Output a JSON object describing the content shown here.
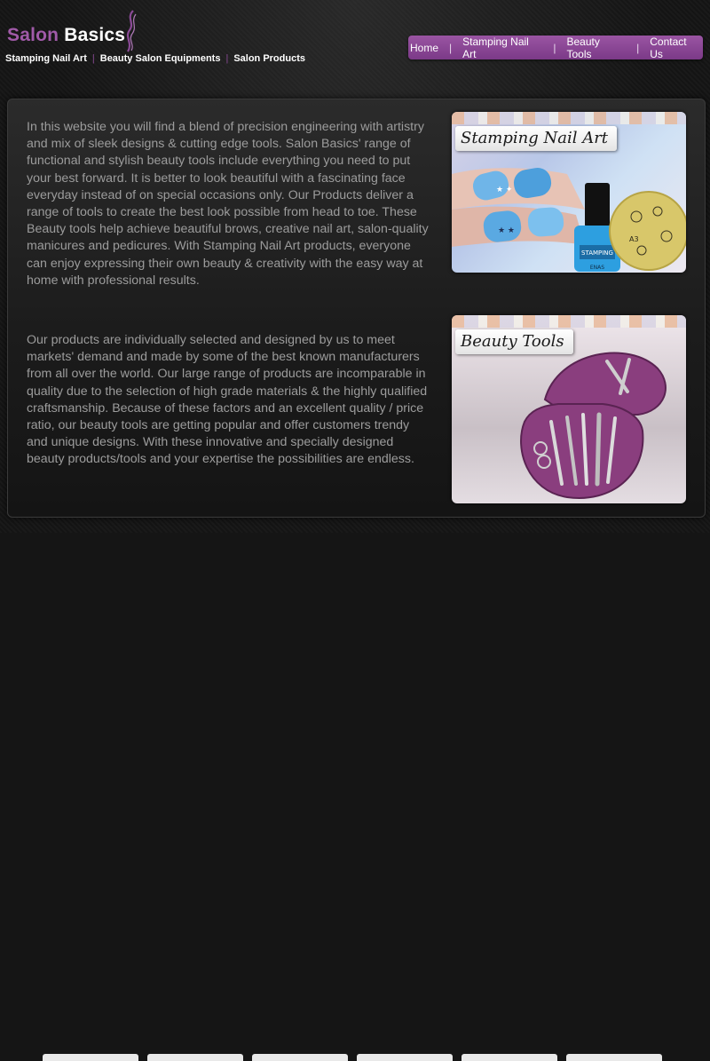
{
  "header": {
    "logo_part1": "Salon ",
    "logo_part2": "Basics",
    "categories": [
      "Stamping Nail Art",
      "Beauty Salon Equipments",
      "Salon Products"
    ],
    "category_separator": "|"
  },
  "nav": {
    "items": [
      "Home",
      "Stamping Nail Art",
      "Beauty Tools",
      "Contact Us"
    ],
    "separator": "|"
  },
  "content": {
    "paragraph1": "In this website you will find a blend of precision engineering with artistry and mix of sleek designs & cutting edge tools. Salon Basics' range of functional and stylish beauty tools include everything you need to put your best forward. It is better to look beautiful with a fascinating face everyday instead of on special occasions only. Our Products deliver a range of tools to create the best look possible from head to toe. These Beauty tools help achieve beautiful brows, creative nail art, salon-quality manicures and pedicures. With Stamping Nail Art products, everyone can enjoy expressing their own beauty & creativity with the easy way at home with professional results.",
    "paragraph2": "Our products are individually selected and designed by us to meet markets' demand and made by some of the best known manufacturers from all over the world. Our large range of products are incomparable in quality due to the selection of high grade materials & the highly qualified craftsmanship. Because of these factors and an excellent quality / price ratio, our beauty tools are getting popular and offer customers trendy and unique designs. With these innovative and specially designed beauty products/tools and your expertise the possibilities are endless."
  },
  "cards": {
    "stamping": {
      "label": "Stamping Nail Art",
      "bottle_text": "STAMPING",
      "bottle_sub": "ENAS",
      "plate_code": "A3"
    },
    "beauty": {
      "label": "Beauty Tools"
    }
  },
  "colors": {
    "brand_purple": "#8b4a97",
    "nav_purple": "#9a55a3",
    "text_gray": "#9c9c9c",
    "background": "#151515"
  }
}
